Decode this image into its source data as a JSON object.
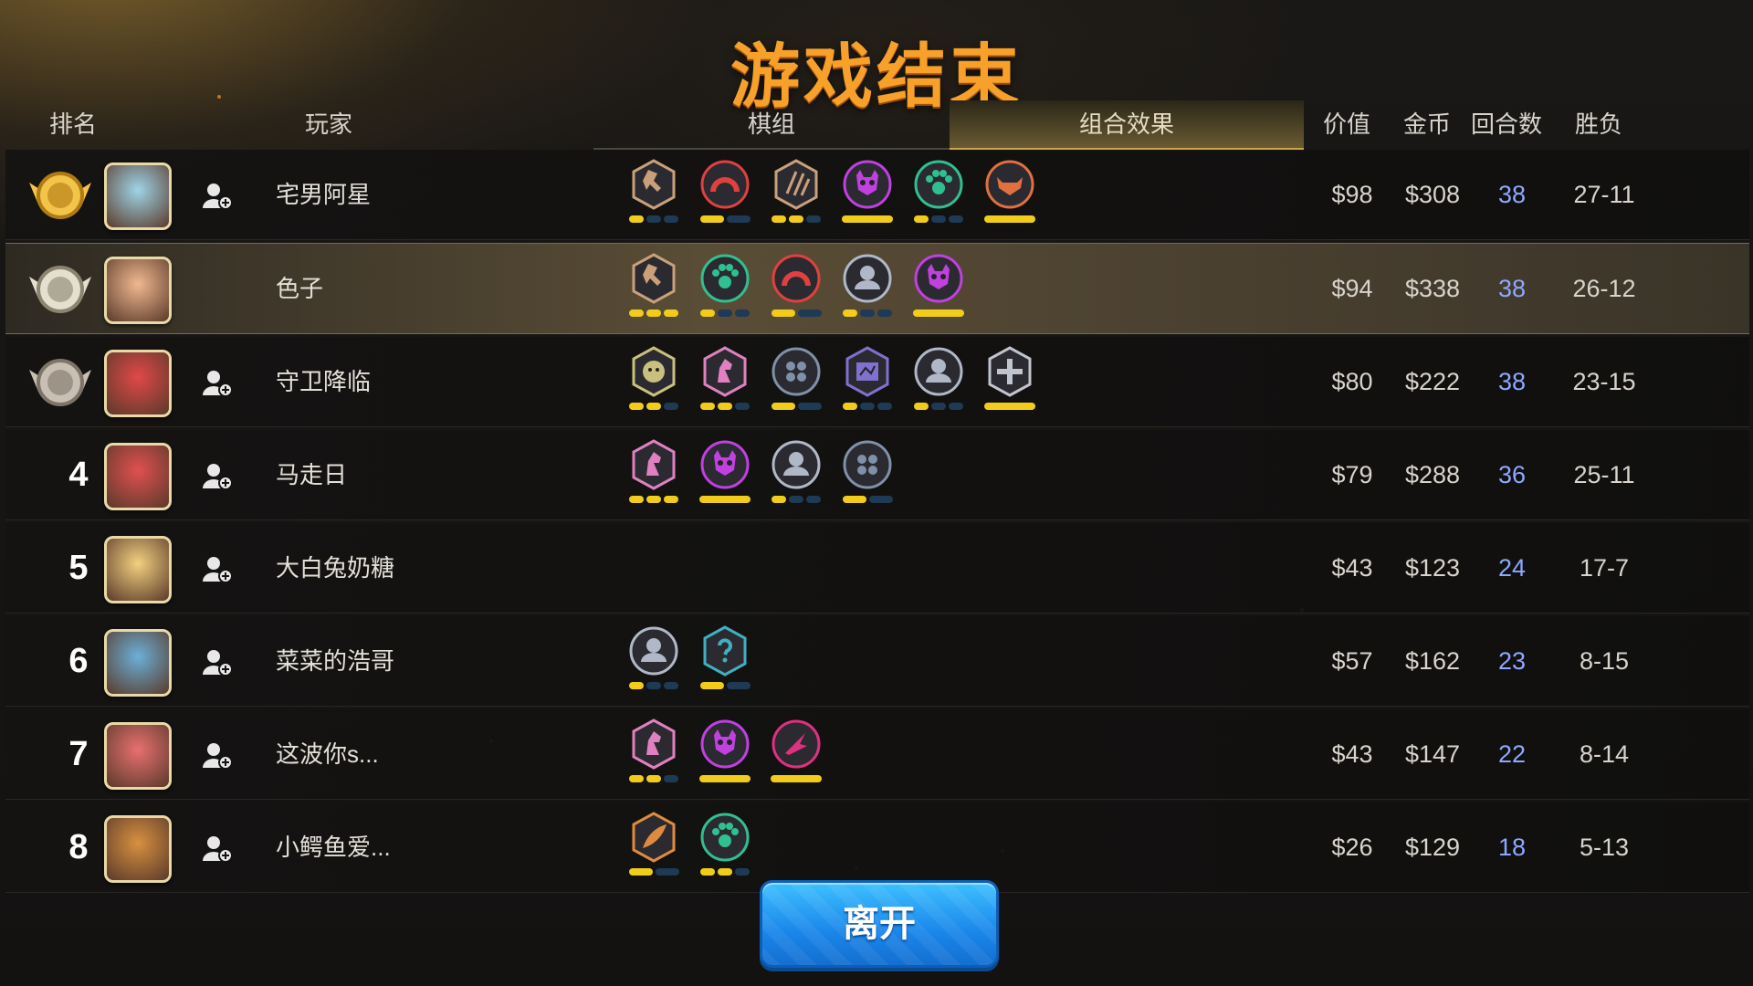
{
  "title": "游戏结束",
  "headers": {
    "rank": "排名",
    "player": "玩家",
    "chess": "棋组",
    "combo": "组合效果",
    "value": "价值",
    "gold": "金币",
    "rounds": "回合数",
    "record": "胜负"
  },
  "leave_label": "离开",
  "colors": {
    "title": "#f7a02a",
    "rounds_text": "#8fa8ff",
    "pip_on": "#f2cc1a",
    "pip_off": "#1e3a55",
    "leave_button": "#1a86ea"
  },
  "players": [
    {
      "rank": "1",
      "medal": "gold-medal-icon",
      "name": "宅男阿星",
      "value": "$98",
      "gold": "$308",
      "rounds": "38",
      "record": "27-11",
      "highlight": false,
      "synergies": [
        {
          "icon": "axe-icon",
          "color": "#c9a07a",
          "pips": [
            1,
            0,
            0
          ]
        },
        {
          "icon": "arch-icon",
          "color": "#e04040",
          "pips": [
            1,
            0
          ]
        },
        {
          "icon": "claws-icon",
          "color": "#c9a07a",
          "pips": [
            1,
            1,
            0
          ]
        },
        {
          "icon": "demon-icon",
          "color": "#c040e0",
          "pips": [
            1
          ]
        },
        {
          "icon": "paw-icon",
          "color": "#30c090",
          "pips": [
            1,
            0,
            0
          ]
        },
        {
          "icon": "horned-helmet-icon",
          "color": "#e07040",
          "pips": [
            1
          ]
        }
      ]
    },
    {
      "rank": "2",
      "medal": "silver-medal-icon",
      "name": "色子",
      "value": "$94",
      "gold": "$338",
      "rounds": "38",
      "record": "26-12",
      "highlight": true,
      "synergies": [
        {
          "icon": "axe-icon",
          "color": "#c9a07a",
          "pips": [
            1,
            1,
            1
          ]
        },
        {
          "icon": "paw-icon",
          "color": "#30c090",
          "pips": [
            1,
            0,
            0
          ]
        },
        {
          "icon": "arch-icon",
          "color": "#e04040",
          "pips": [
            1,
            0
          ]
        },
        {
          "icon": "human-icon",
          "color": "#b0b8c8",
          "pips": [
            1,
            0,
            0
          ]
        },
        {
          "icon": "demon-icon",
          "color": "#c040e0",
          "pips": [
            1
          ]
        }
      ]
    },
    {
      "rank": "3",
      "medal": "bronze-medal-icon",
      "name": "守卫降临",
      "value": "$80",
      "gold": "$222",
      "rounds": "38",
      "record": "23-15",
      "highlight": false,
      "synergies": [
        {
          "icon": "lion-icon",
          "color": "#c9c080",
          "pips": [
            1,
            1,
            0
          ]
        },
        {
          "icon": "knight-icon",
          "color": "#e080c0",
          "pips": [
            1,
            1,
            0
          ]
        },
        {
          "icon": "troll-icon",
          "color": "#8090a8",
          "pips": [
            1,
            0
          ]
        },
        {
          "icon": "mage-icon",
          "color": "#8070d0",
          "pips": [
            1,
            0,
            0
          ]
        },
        {
          "icon": "human-icon",
          "color": "#b0b8c8",
          "pips": [
            1,
            0,
            0
          ]
        },
        {
          "icon": "cross-icon",
          "color": "#c0c4cc",
          "pips": [
            1
          ]
        }
      ]
    },
    {
      "rank": "4",
      "medal": "",
      "name": "马走日",
      "value": "$79",
      "gold": "$288",
      "rounds": "36",
      "record": "25-11",
      "highlight": false,
      "synergies": [
        {
          "icon": "knight-icon",
          "color": "#e080c0",
          "pips": [
            1,
            1,
            1
          ]
        },
        {
          "icon": "demon-icon",
          "color": "#c040e0",
          "pips": [
            1
          ]
        },
        {
          "icon": "human-icon",
          "color": "#b0b8c8",
          "pips": [
            1,
            0,
            0
          ]
        },
        {
          "icon": "troll-icon",
          "color": "#8090a8",
          "pips": [
            1,
            0
          ]
        }
      ]
    },
    {
      "rank": "5",
      "medal": "",
      "name": "大白兔奶糖",
      "value": "$43",
      "gold": "$123",
      "rounds": "24",
      "record": "17-7",
      "highlight": false,
      "synergies": []
    },
    {
      "rank": "6",
      "medal": "",
      "name": "菜菜的浩哥",
      "value": "$57",
      "gold": "$162",
      "rounds": "23",
      "record": "8-15",
      "highlight": false,
      "synergies": [
        {
          "icon": "human-icon",
          "color": "#b0b8c8",
          "pips": [
            1,
            0,
            0
          ]
        },
        {
          "icon": "mystery-icon",
          "color": "#40b0c0",
          "pips": [
            1,
            0
          ]
        }
      ]
    },
    {
      "rank": "7",
      "medal": "",
      "name": "这波你s...",
      "value": "$43",
      "gold": "$147",
      "rounds": "22",
      "record": "8-14",
      "highlight": false,
      "synergies": [
        {
          "icon": "knight-icon",
          "color": "#e080c0",
          "pips": [
            1,
            1,
            0
          ]
        },
        {
          "icon": "demon-icon",
          "color": "#c040e0",
          "pips": [
            1
          ]
        },
        {
          "icon": "assassin-icon",
          "color": "#e03080",
          "pips": [
            1
          ]
        }
      ]
    },
    {
      "rank": "8",
      "medal": "",
      "name": "小鳄鱼爱...",
      "value": "$26",
      "gold": "$129",
      "rounds": "18",
      "record": "5-13",
      "highlight": false,
      "synergies": [
        {
          "icon": "feather-icon",
          "color": "#e08a40",
          "pips": [
            1,
            0
          ]
        },
        {
          "icon": "paw-icon",
          "color": "#30c090",
          "pips": [
            1,
            1,
            0
          ]
        }
      ]
    }
  ]
}
